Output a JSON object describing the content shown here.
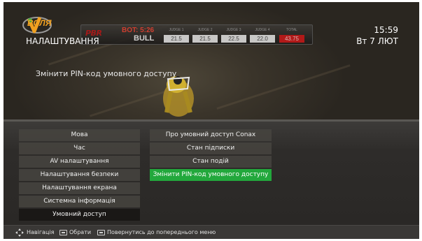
{
  "header": {
    "brand": "ВОЛЯ",
    "title": "НАЛАШТУВАННЯ",
    "time": "15:59",
    "date": "Вт 7 ЛЮТ"
  },
  "scoreboard": {
    "league": "PBR",
    "bot_label": "BOT: 5:26",
    "bull_label": "BULL",
    "judges": [
      {
        "label": "JUDGE 1",
        "value": "21.5"
      },
      {
        "label": "JUDGE 2",
        "value": "21.5"
      },
      {
        "label": "JUDGE 3",
        "value": "22.5"
      },
      {
        "label": "JUDGE 4",
        "value": "22.0"
      }
    ],
    "total_label": "TOTAL",
    "total_value": "43.75"
  },
  "description": "Змінити PIN-код умовного доступу",
  "menu": {
    "left": [
      {
        "label": "Мова",
        "active": false
      },
      {
        "label": "Час",
        "active": false
      },
      {
        "label": "AV налаштування",
        "active": false
      },
      {
        "label": "Налаштування безпеки",
        "active": false
      },
      {
        "label": "Налаштування екрана",
        "active": false
      },
      {
        "label": "Системна інформація",
        "active": false
      },
      {
        "label": "Умовний доступ",
        "active": true
      }
    ],
    "right": [
      {
        "label": "Про умовний доступ Conax",
        "selected": false
      },
      {
        "label": "Стан підписки",
        "selected": false
      },
      {
        "label": "Стан подій",
        "selected": false
      },
      {
        "label": "Змінити PIN-код умовного доступу",
        "selected": true
      }
    ]
  },
  "help": {
    "navigate": "Навігація",
    "select": "Обрати",
    "back": "Повернутись до попереднього меню"
  },
  "colors": {
    "selected": "#22a83c",
    "brand": "#f0a020"
  }
}
